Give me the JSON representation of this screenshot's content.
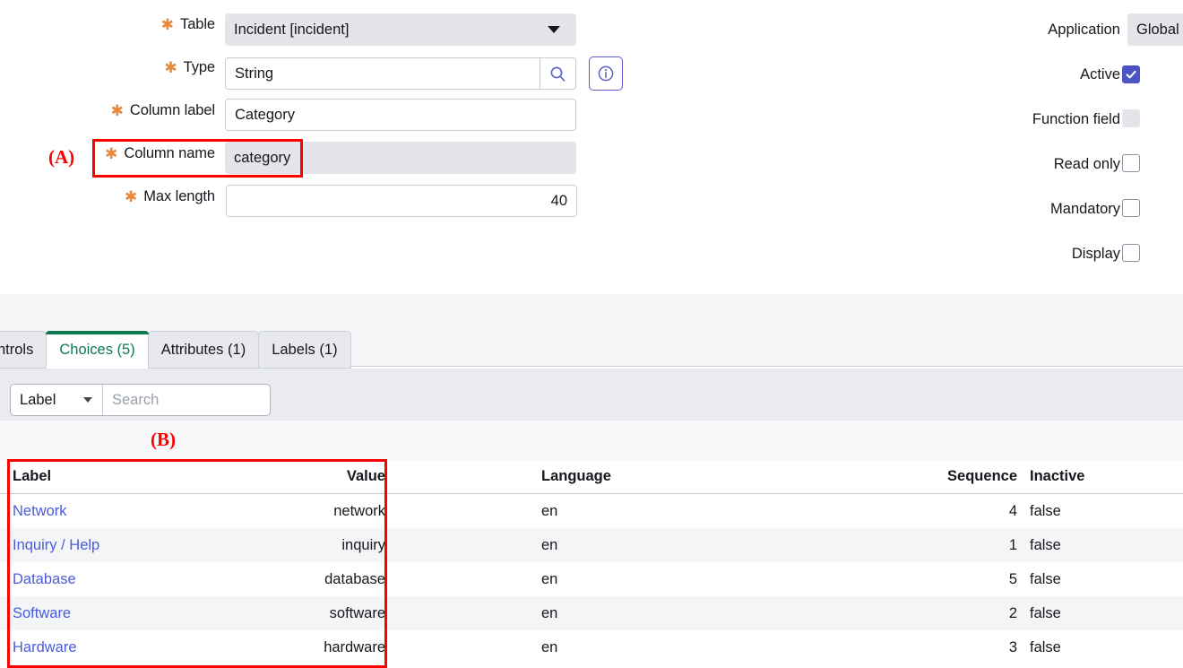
{
  "form": {
    "left_fields": [
      {
        "label": "Table",
        "required": true,
        "value": "Incident [incident]",
        "control": "select-readonly"
      },
      {
        "label": "Type",
        "required": true,
        "value": "String",
        "control": "lookup"
      },
      {
        "label": "Column label",
        "required": true,
        "value": "Category",
        "control": "text"
      },
      {
        "label": "Column name",
        "required": true,
        "value": "category",
        "control": "readonly"
      },
      {
        "label": "Max length",
        "required": true,
        "value": "40",
        "control": "number"
      }
    ],
    "right_fields": [
      {
        "label": "Application",
        "value": "Global",
        "control": "readonly"
      },
      {
        "label": "Active",
        "value": "",
        "control": "checkbox",
        "checked": true
      },
      {
        "label": "Function field",
        "value": "",
        "control": "checkbox",
        "disabled": true
      },
      {
        "label": "Read only",
        "value": "",
        "control": "checkbox",
        "checked": false
      },
      {
        "label": "Mandatory",
        "value": "",
        "control": "checkbox",
        "checked": false
      },
      {
        "label": "Display",
        "value": "",
        "control": "checkbox",
        "checked": false
      }
    ],
    "icons": {
      "lookup": "search-icon",
      "info": "info-icon",
      "dropdown": "chevron-down-icon"
    }
  },
  "tabs": [
    {
      "label": "ntrols",
      "active": false
    },
    {
      "label": "Choices (5)",
      "active": true
    },
    {
      "label": "Attributes (1)",
      "active": false
    },
    {
      "label": "Labels (1)",
      "active": false
    }
  ],
  "search": {
    "field_selector": "Label",
    "placeholder": "Search",
    "value": ""
  },
  "table": {
    "columns": [
      "Label",
      "Value",
      "Language",
      "Sequence",
      "Inactive"
    ],
    "rows": [
      {
        "label": "Network",
        "value": "network",
        "language": "en",
        "sequence": "4",
        "inactive": "false"
      },
      {
        "label": "Inquiry / Help",
        "value": "inquiry",
        "language": "en",
        "sequence": "1",
        "inactive": "false"
      },
      {
        "label": "Database",
        "value": "database",
        "language": "en",
        "sequence": "5",
        "inactive": "false"
      },
      {
        "label": "Software",
        "value": "software",
        "language": "en",
        "sequence": "2",
        "inactive": "false"
      },
      {
        "label": "Hardware",
        "value": "hardware",
        "language": "en",
        "sequence": "3",
        "inactive": "false"
      }
    ]
  },
  "annotations": [
    {
      "id": "A",
      "label": "(A)"
    },
    {
      "id": "B",
      "label": "(B)"
    }
  ],
  "colors": {
    "required_asterisk": "#e8883a",
    "link": "#4a5cdb",
    "checkbox_checked": "#4b54c4",
    "active_tab_text": "#0c7a55",
    "active_tab_bar": "#0b7b4f",
    "annotation": "#ff0000",
    "readonly_bg": "#e3e5ea"
  }
}
